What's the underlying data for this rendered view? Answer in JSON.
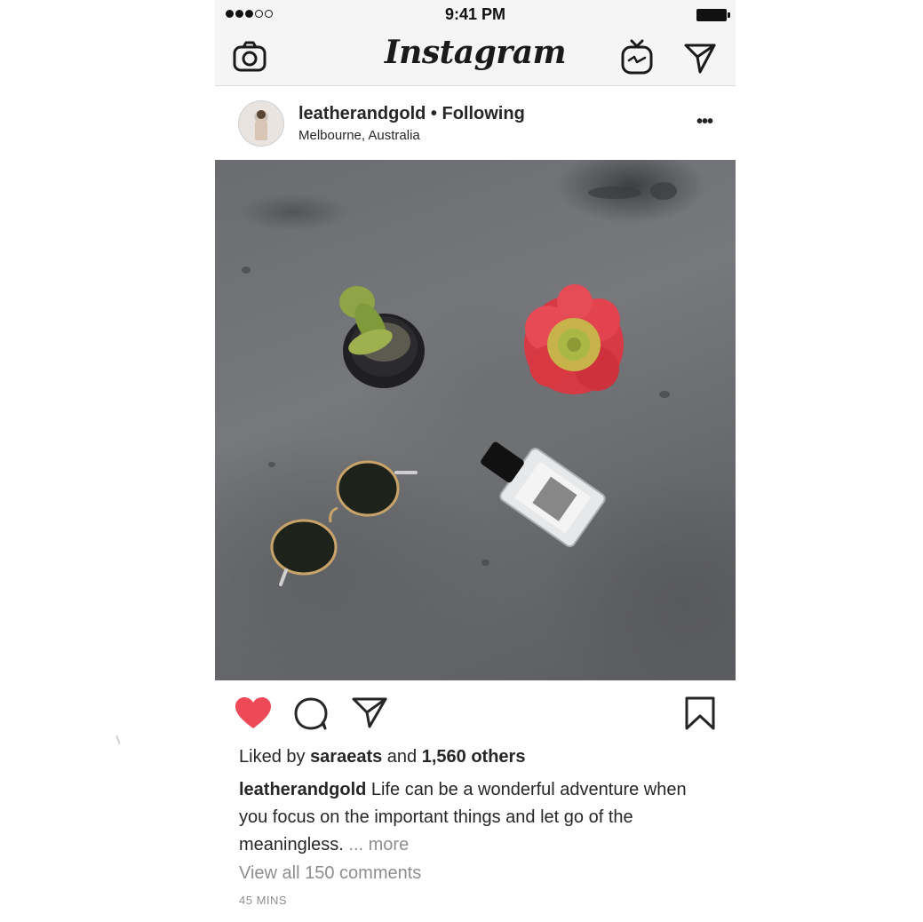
{
  "status_bar": {
    "time": "9:41 PM",
    "signal_dots": [
      true,
      true,
      true,
      false,
      false
    ]
  },
  "nav": {
    "logo": "Instagram",
    "icons": [
      "camera-icon",
      "igtv-icon",
      "direct-message-icon"
    ]
  },
  "post": {
    "username": "leatherandgold",
    "separator": " • ",
    "follow_status": "Following",
    "location": "Melbourne, Australia",
    "more_label": "•••",
    "photo_description_icon": "photo",
    "liked": true,
    "like_color": "#ED4956",
    "likes": {
      "prefix": "Liked by ",
      "user": "saraeats",
      "middle": " and ",
      "count": "1,560 others"
    },
    "caption": {
      "user": "leatherandgold",
      "text": " Life can be a wonderful adventure when you focus on the important things and let go of the meaningless.",
      "more": " ... more"
    },
    "view_comments": "View all 150 comments",
    "timestamp": "45 MINS"
  }
}
